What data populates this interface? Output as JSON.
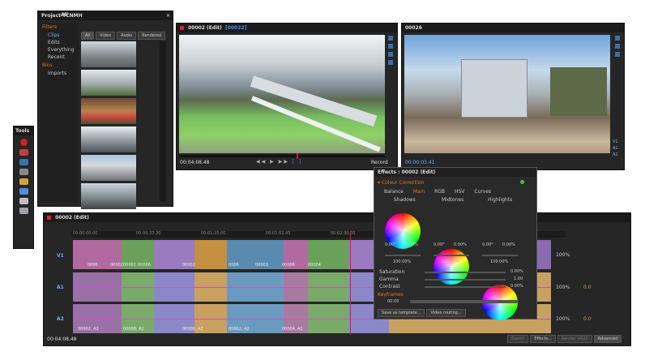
{
  "project": {
    "title": "Project TCNMH"
  },
  "library": {
    "tabs": [
      "All",
      "Video",
      "Audio",
      "Rendered"
    ],
    "search_label": "All",
    "sidebar": [
      {
        "label": "Filters",
        "header": true
      },
      {
        "label": "Clips"
      },
      {
        "label": "Edits"
      },
      {
        "label": "Everything"
      },
      {
        "label": "Recent"
      },
      {
        "label": "Bins",
        "header": true
      },
      {
        "label": "Imports"
      }
    ]
  },
  "source_viewer": {
    "title": "00002 (Edit)",
    "subtitle": "[00022]",
    "timecode": "00:04:08.48",
    "record_label": "Record"
  },
  "record_viewer": {
    "title": "00026",
    "timecode": "00:00:03.41",
    "tracks": [
      "V1",
      "A1",
      "A2"
    ]
  },
  "tools_panel": {
    "title": "Tools"
  },
  "timeline": {
    "title": "00002 (Edit)",
    "ruler": [
      "00:00:00.00",
      "00:00:37.30",
      "00:01:15.00",
      "00:01:52.45",
      "00:02:30.00"
    ],
    "tracks": [
      {
        "name": "V1",
        "zoom": "100%"
      },
      {
        "name": "A1",
        "zoom": "100%",
        "gain": "0.0"
      },
      {
        "name": "A2",
        "zoom": "100%",
        "gain": "0.0"
      }
    ],
    "clip_labels": [
      "0006",
      "00002",
      "00002",
      "00006",
      "00002",
      "0006",
      "00003",
      "00006",
      "00004"
    ],
    "audio_clip_labels": [
      "00002, A2",
      "00008, A2",
      "00006, A2",
      "00002, A2",
      "00004, A2"
    ],
    "end_timecode": "00:04:08.48",
    "buttons": [
      "Export",
      "Effects...",
      "Render VR20",
      "Advanced"
    ]
  },
  "effects": {
    "title": "Effects : 00002 (Edit)",
    "section": "Colour Correction",
    "tabs": [
      "Balance",
      "Main",
      "RGB",
      "HSV",
      "Curves"
    ],
    "active_tab": "Main",
    "wheels": [
      {
        "name": "Shadows",
        "a": "0.00°",
        "b": "0.00%",
        "c": "100.00%"
      },
      {
        "name": "Midtones",
        "a": "0.00°",
        "b": "0.00%",
        "c": "100.00%"
      },
      {
        "name": "Highlights",
        "a": "0.00°",
        "b": "0.00%",
        "c": "100.00%"
      }
    ],
    "sliders": [
      {
        "name": "Saturation",
        "value": "0.00%"
      },
      {
        "name": "Gamma",
        "value": "1.00"
      },
      {
        "name": "Contrast",
        "value": "0.00%"
      }
    ],
    "keyframes_label": "Keyframes",
    "keyframe_time": "00:00",
    "save_template": "Save as template...",
    "video_routing": "Video routing..."
  }
}
